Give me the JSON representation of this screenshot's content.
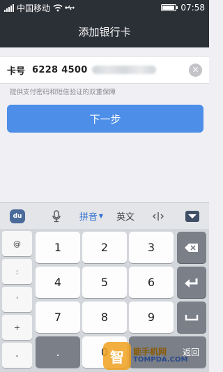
{
  "status_bar": {
    "carrier": "中国移动",
    "time": "07:58",
    "battery_level": 0.9,
    "icons": [
      "signal-icon",
      "wifi-icon",
      "usb-icon",
      "battery-icon"
    ]
  },
  "nav": {
    "title": "添加银行卡"
  },
  "card_field": {
    "label": "卡号",
    "value_visible": "6228 4500",
    "clear_icon": "clear-icon"
  },
  "hint": "提供支付密码和短信验证的双重保障",
  "next_button": {
    "label": "下一步"
  },
  "keyboard_toolbar": {
    "logo": "du",
    "mic_icon": "microphone-icon",
    "pinyin_label": "拼音",
    "english_label": "英文",
    "cursor_icon": "cursor-move-icon",
    "hide_icon": "hide-keyboard-icon"
  },
  "keyboard": {
    "symbols": [
      "@",
      ":",
      "'",
      "+",
      "-"
    ],
    "digits": [
      "1",
      "2",
      "3",
      "4",
      "5",
      "6",
      "7",
      "8",
      "9",
      "0"
    ],
    "dot": ".",
    "return_label": "返回",
    "backspace_icon": "backspace-icon",
    "enter_icon": "enter-icon",
    "space_icon": "space-icon"
  },
  "watermark": {
    "cn": "能手机网",
    "en": "TOMPDA.COM",
    "colors": {
      "logo": "#f2a120",
      "cn": "#8a5a00",
      "en": "#2b4a8a"
    }
  },
  "colors": {
    "accent": "#4d8ee8",
    "header": "#2b2f36"
  }
}
